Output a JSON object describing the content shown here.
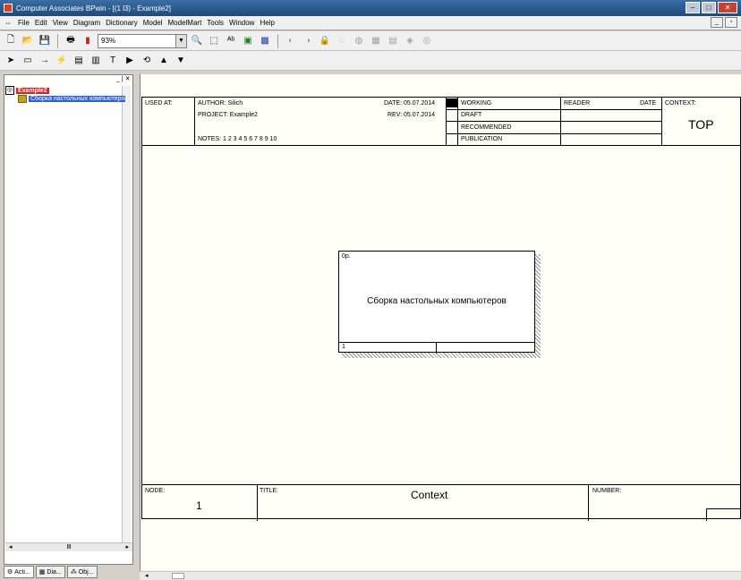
{
  "window": {
    "title": "Computer Associates BPwin - [(1 l3) - Example2]"
  },
  "menu": [
    "File",
    "Edit",
    "View",
    "Diagram",
    "Dictionary",
    "Model",
    "ModelMart",
    "Tools",
    "Window",
    "Help"
  ],
  "toolbar": {
    "zoom": "93%"
  },
  "tree": {
    "root": "Example2",
    "child": "Сборка настольных компьютеров"
  },
  "tabs": [
    "Acti...",
    "Dia...",
    "Obj..."
  ],
  "header": {
    "used_at": "USED AT:",
    "author": "AUTHOR: Silich",
    "project": "PROJECT: Example2",
    "notes": "NOTES: 1 2 3 4 5 6 7 8 9 10",
    "date": "DATE: 05.07.2014",
    "rev": "REV: 05.07.2014",
    "status": [
      "WORKING",
      "DRAFT",
      "RECOMMENDED",
      "PUBLICATION"
    ],
    "reader": "READER",
    "reader_date": "DATE",
    "context": "CONTEXT:",
    "context_value": "TOP"
  },
  "activity": {
    "cost": "0р.",
    "name": "Сборка настольных компьютеров",
    "number": "1"
  },
  "footer": {
    "node": "NODE:",
    "node_value": "1",
    "title": "TITLE:",
    "title_value": "Context",
    "number": "NUMBER:"
  }
}
